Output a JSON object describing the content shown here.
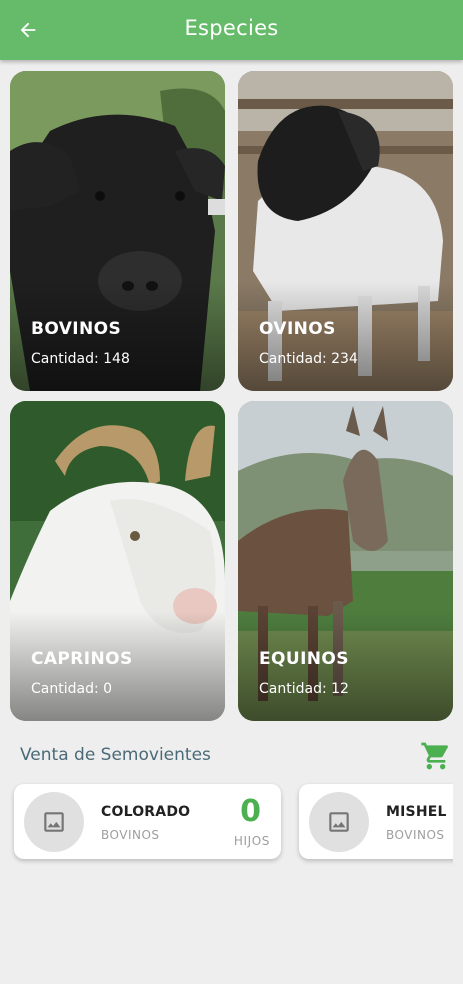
{
  "app_bar": {
    "title": "Especies",
    "back_icon": "arrow-left-icon",
    "color": "#66bb6a"
  },
  "species": [
    {
      "name": "BOVINOS",
      "count_label": "Cantidad: 148"
    },
    {
      "name": "OVINOS",
      "count_label": "Cantidad: 234"
    },
    {
      "name": "CAPRINOS",
      "count_label": "Cantidad: 0"
    },
    {
      "name": "EQUINOS",
      "count_label": "Cantidad: 12"
    }
  ],
  "sales": {
    "title": "Venta de Semovientes",
    "cart_icon": "shopping-cart-icon",
    "accent": "#4caf50",
    "items": [
      {
        "name": "COLORADO",
        "species": "BOVINOS",
        "hijos_value": "0",
        "hijos_label": "HIJOS",
        "thumb_icon": "image-placeholder-icon"
      },
      {
        "name": "MISHEL",
        "species": "BOVINOS",
        "thumb_icon": "image-placeholder-icon"
      }
    ]
  }
}
